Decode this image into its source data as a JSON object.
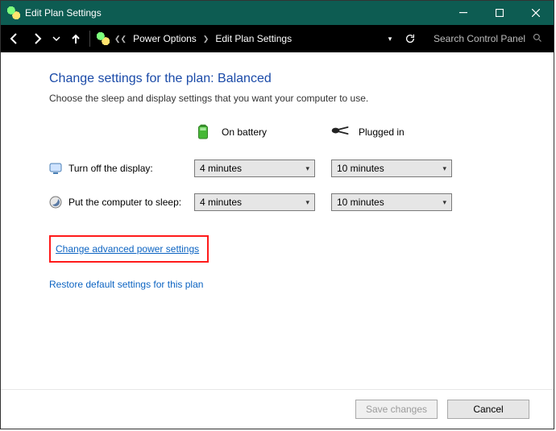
{
  "window": {
    "title": "Edit Plan Settings"
  },
  "breadcrumb": {
    "a": "Power Options",
    "b": "Edit Plan Settings"
  },
  "search": {
    "placeholder": "Search Control Panel"
  },
  "page": {
    "heading": "Change settings for the plan: Balanced",
    "subtext": "Choose the sleep and display settings that you want your computer to use."
  },
  "columns": {
    "battery": "On battery",
    "plugged": "Plugged in"
  },
  "settings": {
    "display": {
      "label": "Turn off the display:",
      "battery": "4 minutes",
      "plugged": "10 minutes"
    },
    "sleep": {
      "label": "Put the computer to sleep:",
      "battery": "4 minutes",
      "plugged": "10 minutes"
    }
  },
  "links": {
    "advanced": "Change advanced power settings",
    "restore": "Restore default settings for this plan"
  },
  "buttons": {
    "save": "Save changes",
    "cancel": "Cancel"
  }
}
